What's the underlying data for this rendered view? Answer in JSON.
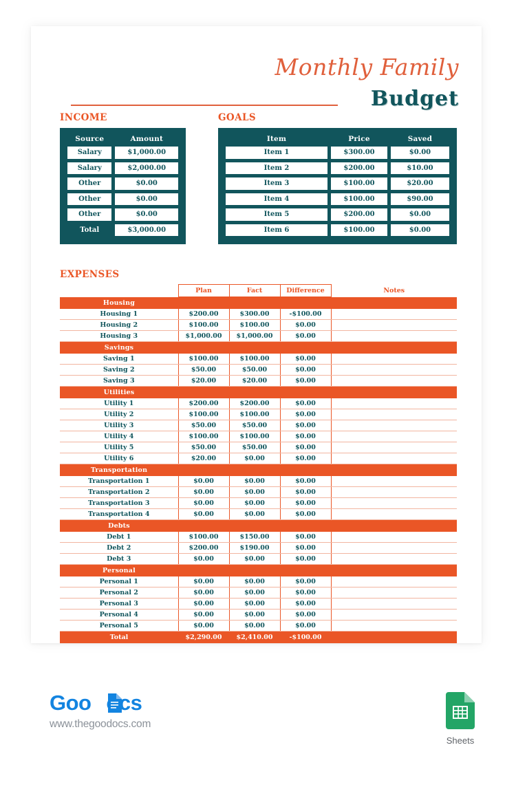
{
  "header": {
    "title_script": "Monthly Family",
    "title_bold": "Budget"
  },
  "income": {
    "section_title": "INCOME",
    "columns": [
      "Source",
      "Amount"
    ],
    "rows": [
      {
        "source": "Salary",
        "amount": "$1,000.00"
      },
      {
        "source": "Salary",
        "amount": "$2,000.00"
      },
      {
        "source": "Other",
        "amount": "$0.00"
      },
      {
        "source": "Other",
        "amount": "$0.00"
      },
      {
        "source": "Other",
        "amount": "$0.00"
      }
    ],
    "total_label": "Total",
    "total_amount": "$3,000.00"
  },
  "goals": {
    "section_title": "GOALS",
    "columns": [
      "Item",
      "Price",
      "Saved"
    ],
    "rows": [
      {
        "item": "Item 1",
        "price": "$300.00",
        "saved": "$0.00"
      },
      {
        "item": "Item 2",
        "price": "$200.00",
        "saved": "$10.00"
      },
      {
        "item": "Item 3",
        "price": "$100.00",
        "saved": "$20.00"
      },
      {
        "item": "Item 4",
        "price": "$100.00",
        "saved": "$90.00"
      },
      {
        "item": "Item 5",
        "price": "$200.00",
        "saved": "$0.00"
      },
      {
        "item": "Item 6",
        "price": "$100.00",
        "saved": "$0.00"
      }
    ]
  },
  "expenses": {
    "section_title": "EXPENSES",
    "columns": [
      "",
      "Plan",
      "Fact",
      "Difference",
      "Notes"
    ],
    "groups": [
      {
        "category": "Housing",
        "rows": [
          {
            "name": "Housing 1",
            "plan": "$200.00",
            "fact": "$300.00",
            "difference": "-$100.00",
            "notes": ""
          },
          {
            "name": "Housing 2",
            "plan": "$100.00",
            "fact": "$100.00",
            "difference": "$0.00",
            "notes": ""
          },
          {
            "name": "Housing 3",
            "plan": "$1,000.00",
            "fact": "$1,000.00",
            "difference": "$0.00",
            "notes": ""
          }
        ]
      },
      {
        "category": "Savings",
        "rows": [
          {
            "name": "Saving 1",
            "plan": "$100.00",
            "fact": "$100.00",
            "difference": "$0.00",
            "notes": ""
          },
          {
            "name": "Saving 2",
            "plan": "$50.00",
            "fact": "$50.00",
            "difference": "$0.00",
            "notes": ""
          },
          {
            "name": "Saving 3",
            "plan": "$20.00",
            "fact": "$20.00",
            "difference": "$0.00",
            "notes": ""
          }
        ]
      },
      {
        "category": "Utilities",
        "rows": [
          {
            "name": "Utility 1",
            "plan": "$200.00",
            "fact": "$200.00",
            "difference": "$0.00",
            "notes": ""
          },
          {
            "name": "Utility 2",
            "plan": "$100.00",
            "fact": "$100.00",
            "difference": "$0.00",
            "notes": ""
          },
          {
            "name": "Utility 3",
            "plan": "$50.00",
            "fact": "$50.00",
            "difference": "$0.00",
            "notes": ""
          },
          {
            "name": "Utility 4",
            "plan": "$100.00",
            "fact": "$100.00",
            "difference": "$0.00",
            "notes": ""
          },
          {
            "name": "Utility 5",
            "plan": "$50.00",
            "fact": "$50.00",
            "difference": "$0.00",
            "notes": ""
          },
          {
            "name": "Utility 6",
            "plan": "$20.00",
            "fact": "$0.00",
            "difference": "$0.00",
            "notes": ""
          }
        ]
      },
      {
        "category": "Transportation",
        "rows": [
          {
            "name": "Transportation 1",
            "plan": "$0.00",
            "fact": "$0.00",
            "difference": "$0.00",
            "notes": ""
          },
          {
            "name": "Transportation 2",
            "plan": "$0.00",
            "fact": "$0.00",
            "difference": "$0.00",
            "notes": ""
          },
          {
            "name": "Transportation 3",
            "plan": "$0.00",
            "fact": "$0.00",
            "difference": "$0.00",
            "notes": ""
          },
          {
            "name": "Transportation 4",
            "plan": "$0.00",
            "fact": "$0.00",
            "difference": "$0.00",
            "notes": ""
          }
        ]
      },
      {
        "category": "Debts",
        "rows": [
          {
            "name": "Debt 1",
            "plan": "$100.00",
            "fact": "$150.00",
            "difference": "$0.00",
            "notes": ""
          },
          {
            "name": "Debt 2",
            "plan": "$200.00",
            "fact": "$190.00",
            "difference": "$0.00",
            "notes": ""
          },
          {
            "name": "Debt 3",
            "plan": "$0.00",
            "fact": "$0.00",
            "difference": "$0.00",
            "notes": ""
          }
        ]
      },
      {
        "category": "Personal",
        "rows": [
          {
            "name": "Personal 1",
            "plan": "$0.00",
            "fact": "$0.00",
            "difference": "$0.00",
            "notes": ""
          },
          {
            "name": "Personal 2",
            "plan": "$0.00",
            "fact": "$0.00",
            "difference": "$0.00",
            "notes": ""
          },
          {
            "name": "Personal 3",
            "plan": "$0.00",
            "fact": "$0.00",
            "difference": "$0.00",
            "notes": ""
          },
          {
            "name": "Personal 4",
            "plan": "$0.00",
            "fact": "$0.00",
            "difference": "$0.00",
            "notes": ""
          },
          {
            "name": "Personal 5",
            "plan": "$0.00",
            "fact": "$0.00",
            "difference": "$0.00",
            "notes": ""
          }
        ]
      }
    ],
    "total": {
      "label": "Total",
      "plan": "$2,290.00",
      "fact": "$2,410.00",
      "difference": "-$100.00",
      "notes": ""
    }
  },
  "footer": {
    "logo_part1": "Goo",
    "logo_part2": "ocs",
    "url": "www.thegoodocs.com",
    "sheets_label": "Sheets",
    "sheets_icon": "google-sheets-icon"
  },
  "colors": {
    "teal": "#11555C",
    "orange": "#EA5626",
    "title_orange": "#E0603C",
    "row_divider": "#F2B5A0",
    "logo_blue": "#1384E0",
    "sheets_green": "#23A566"
  }
}
